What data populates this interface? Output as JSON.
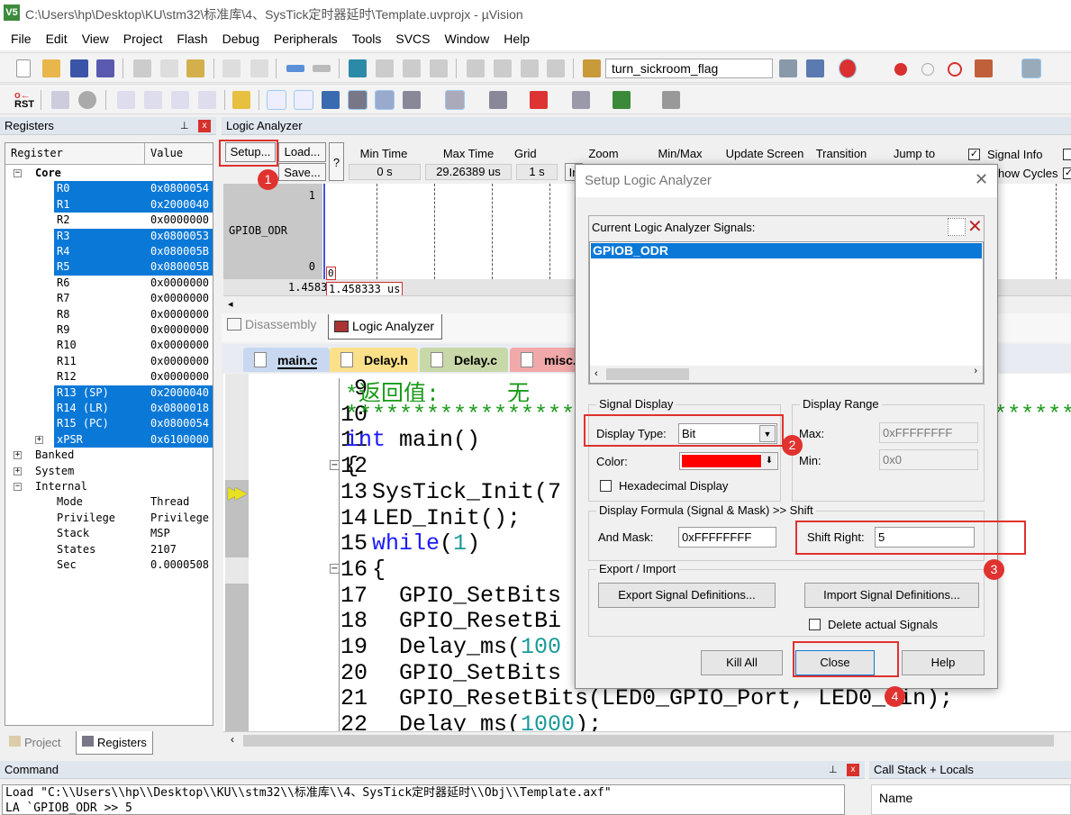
{
  "window": {
    "title": "C:\\Users\\hp\\Desktop\\KU\\stm32\\标准库\\4、SysTick定时器延时\\Template.uvprojx - µVision",
    "app_icon": "V5"
  },
  "menu": [
    "File",
    "Edit",
    "View",
    "Project",
    "Flash",
    "Debug",
    "Peripherals",
    "Tools",
    "SVCS",
    "Window",
    "Help"
  ],
  "toolbar": {
    "target_combo": "turn_sickroom_flag",
    "rst_label": "RST"
  },
  "registers": {
    "title": "Registers",
    "col_register": "Register",
    "col_value": "Value",
    "core_label": "Core",
    "rows": [
      {
        "name": "R0",
        "value": "0x0800054",
        "selected": true
      },
      {
        "name": "R1",
        "value": "0x2000040",
        "selected": true
      },
      {
        "name": "R2",
        "value": "0x0000000",
        "selected": false
      },
      {
        "name": "R3",
        "value": "0x0800053",
        "selected": true
      },
      {
        "name": "R4",
        "value": "0x080005B",
        "selected": true
      },
      {
        "name": "R5",
        "value": "0x080005B",
        "selected": true
      },
      {
        "name": "R6",
        "value": "0x0000000",
        "selected": false
      },
      {
        "name": "R7",
        "value": "0x0000000",
        "selected": false
      },
      {
        "name": "R8",
        "value": "0x0000000",
        "selected": false
      },
      {
        "name": "R9",
        "value": "0x0000000",
        "selected": false
      },
      {
        "name": "R10",
        "value": "0x0000000",
        "selected": false
      },
      {
        "name": "R11",
        "value": "0x0000000",
        "selected": false
      },
      {
        "name": "R12",
        "value": "0x0000000",
        "selected": false
      },
      {
        "name": "R13 (SP)",
        "value": "0x2000040",
        "selected": true
      },
      {
        "name": "R14 (LR)",
        "value": "0x0800018",
        "selected": true
      },
      {
        "name": "R15 (PC)",
        "value": "0x0800054",
        "selected": true
      },
      {
        "name": "xPSR",
        "value": "0x6100000",
        "selected": true,
        "expandable": true
      }
    ],
    "groups": [
      "Banked",
      "System",
      "Internal"
    ],
    "internal": [
      {
        "name": "Mode",
        "value": "Thread"
      },
      {
        "name": "Privilege",
        "value": "Privilege"
      },
      {
        "name": "Stack",
        "value": "MSP"
      },
      {
        "name": "States",
        "value": "2107"
      },
      {
        "name": "Sec",
        "value": "0.0000508"
      }
    ],
    "tabs": [
      "Project",
      "Registers"
    ]
  },
  "logic_analyzer": {
    "title": "Logic Analyzer",
    "setup": "Setup...",
    "load": "Load...",
    "save": "Save...",
    "help": "?",
    "min_time_label": "Min Time",
    "min_time": "0 s",
    "max_time_label": "Max Time",
    "max_time": "29.26389 us",
    "grid_label": "Grid",
    "grid": "1 s",
    "zoom_label": "Zoom",
    "zoom_in": "In",
    "minmax_label": "Min/Max",
    "update_label": "Update Screen",
    "transition_label": "Transition",
    "jumpto_label": "Jump to",
    "signal_info": "Signal Info",
    "signal_info_checked": true,
    "show_cycles": "how Cycles",
    "show_cycles_checked": true,
    "signal": "GPIOB_ODR",
    "y_high": "1",
    "y_low": "0",
    "time_left": "1.45833",
    "cursor_value": "0",
    "cursor_time": "1.458333 us"
  },
  "view_tabs": [
    "Disassembly",
    "Logic Analyzer"
  ],
  "file_tabs": [
    {
      "name": "main.c",
      "color": "#c8d8f0"
    },
    {
      "name": "Delay.h",
      "color": "#fbe08a"
    },
    {
      "name": "Delay.c",
      "color": "#c8d8a8"
    },
    {
      "name": "misc.c",
      "color": "#f0a8a8"
    }
  ],
  "code": [
    {
      "n": "9",
      "tokens": [
        {
          "t": "*返回值:     无",
          "k": "cm"
        }
      ]
    },
    {
      "n": "10",
      "tokens": [
        {
          "t": "**************************************************************",
          "k": "cm"
        }
      ]
    },
    {
      "n": "11",
      "tokens": [
        {
          "t": "int",
          "k": "kw"
        },
        {
          "t": " main()",
          "k": ""
        }
      ]
    },
    {
      "n": "12",
      "fold": true,
      "tokens": [
        {
          "t": "{",
          "k": ""
        }
      ]
    },
    {
      "n": "13",
      "tokens": [
        {
          "t": "  SysTick_Init(7",
          "k": ""
        }
      ]
    },
    {
      "n": "14",
      "tokens": [
        {
          "t": "  LED_Init();",
          "k": ""
        }
      ]
    },
    {
      "n": "15",
      "tokens": [
        {
          "t": "  ",
          "k": ""
        },
        {
          "t": "while",
          "k": "kw"
        },
        {
          "t": "(",
          "k": ""
        },
        {
          "t": "1",
          "k": "num"
        },
        {
          "t": ")",
          "k": ""
        }
      ]
    },
    {
      "n": "16",
      "fold": true,
      "tokens": [
        {
          "t": "  {",
          "k": ""
        }
      ]
    },
    {
      "n": "17",
      "tokens": [
        {
          "t": "    GPIO_SetBits",
          "k": ""
        }
      ]
    },
    {
      "n": "18",
      "tokens": [
        {
          "t": "    GPIO_ResetBi",
          "k": ""
        }
      ]
    },
    {
      "n": "19",
      "tokens": [
        {
          "t": "    Delay_ms(",
          "k": ""
        },
        {
          "t": "100",
          "k": "num"
        }
      ]
    },
    {
      "n": "20",
      "tokens": [
        {
          "t": "    GPIO_SetBits",
          "k": ""
        }
      ]
    },
    {
      "n": "21",
      "tokens": [
        {
          "t": "    GPIO_ResetBits(LED0_GPIO_Port, LED0_Pin);",
          "k": ""
        }
      ]
    },
    {
      "n": "22",
      "tokens": [
        {
          "t": "    Delay_ms(",
          "k": ""
        },
        {
          "t": "1000",
          "k": "num"
        },
        {
          "t": ");",
          "k": ""
        }
      ]
    }
  ],
  "command": {
    "title": "Command",
    "lines": [
      "Load \"C:\\\\Users\\\\hp\\\\Desktop\\\\KU\\\\stm32\\\\标准库\\\\4、SysTick定时器延时\\\\Obj\\\\Template.axf\"",
      "LA `GPIOB_ODR >> 5"
    ]
  },
  "callstack": {
    "title": "Call Stack + Locals",
    "col_name": "Name"
  },
  "dialog": {
    "title": "Setup Logic Analyzer",
    "signals_label": "Current Logic Analyzer Signals:",
    "signals": [
      "GPIOB_ODR"
    ],
    "signal_display": "Signal Display",
    "display_type_label": "Display Type:",
    "display_type": "Bit",
    "color_label": "Color:",
    "color": "#ff0000",
    "hex_label": "Hexadecimal Display",
    "hex_checked": false,
    "display_range": "Display Range",
    "max_label": "Max:",
    "max": "0xFFFFFFFF",
    "min_label": "Min:",
    "min": "0x0",
    "formula": "Display Formula (Signal & Mask) >> Shift",
    "and_mask_label": "And Mask:",
    "and_mask": "0xFFFFFFFF",
    "shift_label": "Shift Right:",
    "shift": "5",
    "export_import": "Export / Import",
    "export_btn": "Export Signal Definitions...",
    "import_btn": "Import Signal Definitions...",
    "delete_label": "Delete actual Signals",
    "delete_checked": false,
    "kill_all": "Kill All",
    "close": "Close",
    "help": "Help"
  },
  "annotations": [
    "1",
    "2",
    "3",
    "4"
  ],
  "annotation_color": "#e0322f"
}
